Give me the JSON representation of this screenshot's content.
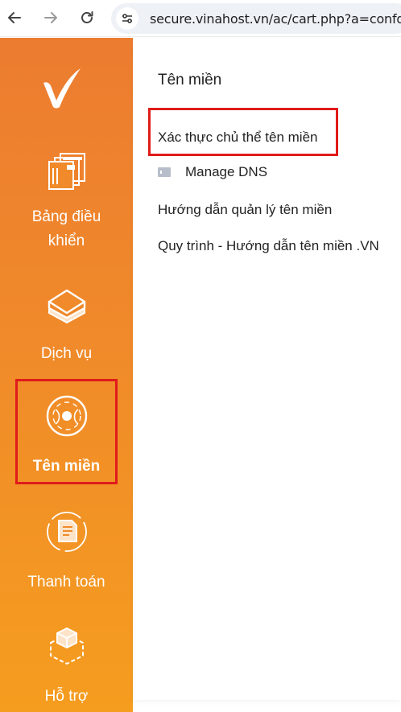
{
  "browser": {
    "url": "secure.vinahost.vn/ac/cart.php?a=confdomains"
  },
  "sidebar": {
    "items": [
      {
        "label_line1": "Bảng điều",
        "label_line2": "khiển",
        "icon": "dashboard-icon"
      },
      {
        "label": "Dịch vụ",
        "icon": "layers-icon"
      },
      {
        "label": "Tên miền",
        "icon": "globe-icon",
        "active": true
      },
      {
        "label": "Thanh toán",
        "icon": "invoice-icon"
      },
      {
        "label": "Hỗ trợ",
        "icon": "support-box-icon"
      }
    ]
  },
  "panel": {
    "title": "Tên miền",
    "links": [
      {
        "label": "Xác thực chủ thể tên miền"
      },
      {
        "label": "Manage DNS",
        "icon": "dns-icon"
      },
      {
        "label": "Hướng dẫn quản lý tên miền"
      },
      {
        "label": "Quy trình - Hướng dẫn tên miền .VN"
      }
    ]
  },
  "colors": {
    "sidebar_top": "#ec7c30",
    "sidebar_bottom": "#f59d1f",
    "highlight": "#e01b1b",
    "text": "#222222"
  }
}
